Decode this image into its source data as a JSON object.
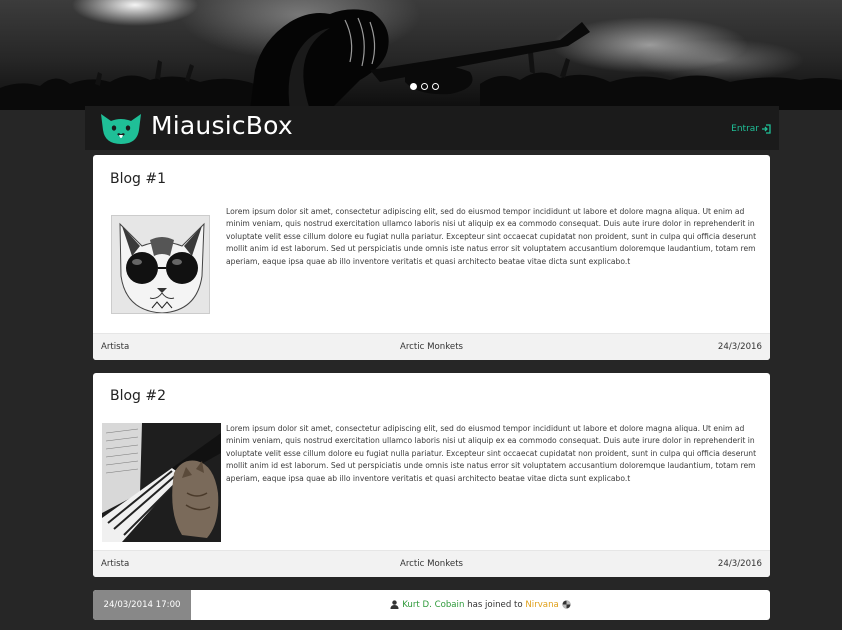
{
  "app": {
    "brand": "MiausicBox",
    "login_label": "Entrar",
    "accent_color": "#1fbf97"
  },
  "hero": {
    "slides_count": 3,
    "active_slide": 1
  },
  "posts": [
    {
      "title": "Blog #1",
      "body": "Lorem ipsum dolor sit amet, consectetur adipiscing elit, sed do eiusmod tempor incididunt ut labore et dolore magna aliqua. Ut enim ad minim veniam, quis nostrud exercitation ullamco laboris nisi ut aliquip ex ea commodo consequat. Duis aute irure dolor in reprehenderit in voluptate velit esse cillum dolore eu fugiat nulla pariatur. Excepteur sint occaecat cupidatat non proident, sunt in culpa qui officia deserunt mollit anim id est laborum. Sed ut perspiciatis unde omnis iste natus error sit voluptatem accusantium doloremque laudantium, totam rem aperiam, eaque ipsa quae ab illo inventore veritatis et quasi architecto beatae vitae dicta sunt explicabo.t",
      "footer_left": "Artista",
      "footer_mid": "Arctic Monkets",
      "footer_right": "24/3/2016",
      "image": "cat-with-sunglasses"
    },
    {
      "title": "Blog #2",
      "body": "Lorem ipsum dolor sit amet, consectetur adipiscing elit, sed do eiusmod tempor incididunt ut labore et dolore magna aliqua. Ut enim ad minim veniam, quis nostrud exercitation ullamco laboris nisi ut aliquip ex ea commodo consequat. Duis aute irure dolor in reprehenderit in voluptate velit esse cillum dolore eu fugiat nulla pariatur. Excepteur sint occaecat cupidatat non proident, sunt in culpa qui officia deserunt mollit anim id est laborum. Sed ut perspiciatis unde omnis iste natus error sit voluptatem accusantium doloremque laudantium, totam rem aperiam, eaque ipsa quae ab illo inventore veritatis et quasi architecto beatae vitae dicta sunt explicabo.t",
      "footer_left": "Artista",
      "footer_mid": "Arctic Monkets",
      "footer_right": "24/3/2016",
      "image": "cat-playing-piano"
    }
  ],
  "activity": {
    "date": "24/03/2014 17:00",
    "user": "Kurt D. Cobain",
    "action": "has joined to",
    "band": "Nirvana",
    "user_color": "#2e9a3a",
    "band_color": "#e0a01a",
    "icons": [
      "user-icon",
      "band-icon"
    ]
  }
}
